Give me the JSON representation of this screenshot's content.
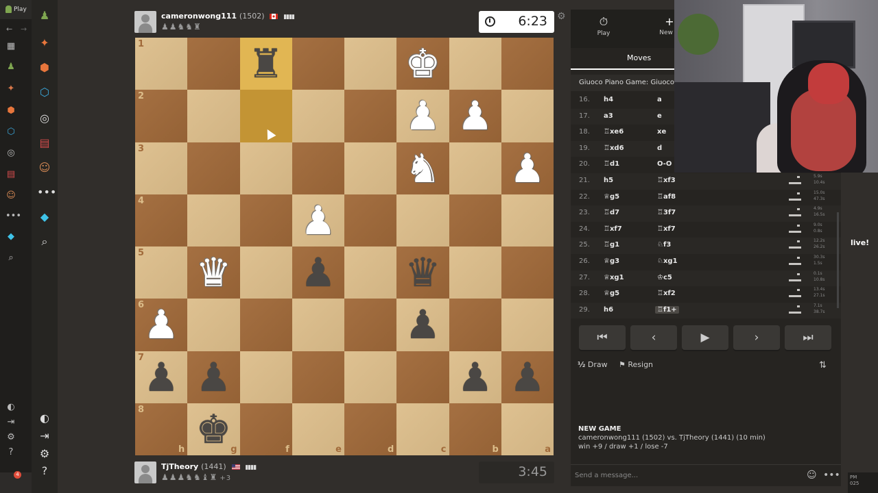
{
  "browser": {
    "tab_label": "Play",
    "notification_count": "4",
    "tray_time": "PM",
    "tray_date": "025"
  },
  "top_player": {
    "name": "cameronwong111",
    "rating": "(1502)",
    "flag": "Canada",
    "captured": "♟♟♞♞♜",
    "clock": "6:23",
    "clock_active": true
  },
  "bottom_player": {
    "name": "TjTheory",
    "rating": "(1441)",
    "flag": "USA",
    "captured": "♟♟♟♞♞♝♜",
    "advantage": "+3",
    "clock": "3:45",
    "clock_active": false
  },
  "board": {
    "orientation": "black",
    "ranks": [
      "1",
      "2",
      "3",
      "4",
      "5",
      "6",
      "7",
      "8"
    ],
    "files": [
      "h",
      "g",
      "f",
      "e",
      "d",
      "c",
      "b",
      "a"
    ],
    "highlighted": [
      "f1",
      "f2"
    ],
    "pieces": [
      {
        "sq": "f1",
        "glyph": "♜",
        "color": "b"
      },
      {
        "sq": "c1",
        "glyph": "♚",
        "color": "w"
      },
      {
        "sq": "c2",
        "glyph": "♟",
        "color": "w"
      },
      {
        "sq": "b2",
        "glyph": "♟",
        "color": "w"
      },
      {
        "sq": "c3",
        "glyph": "♞",
        "color": "w"
      },
      {
        "sq": "a3",
        "glyph": "♟",
        "color": "w"
      },
      {
        "sq": "e4",
        "glyph": "♟",
        "color": "w"
      },
      {
        "sq": "g5",
        "glyph": "♛",
        "color": "w"
      },
      {
        "sq": "e5",
        "glyph": "♟",
        "color": "b"
      },
      {
        "sq": "c5",
        "glyph": "♛",
        "color": "b"
      },
      {
        "sq": "h6",
        "glyph": "♟",
        "color": "w"
      },
      {
        "sq": "c6",
        "glyph": "♟",
        "color": "b"
      },
      {
        "sq": "h7",
        "glyph": "♟",
        "color": "b"
      },
      {
        "sq": "g7",
        "glyph": "♟",
        "color": "b"
      },
      {
        "sq": "b7",
        "glyph": "♟",
        "color": "b"
      },
      {
        "sq": "a7",
        "glyph": "♟",
        "color": "b"
      },
      {
        "sq": "g8",
        "glyph": "♚",
        "color": "b"
      }
    ]
  },
  "panel": {
    "tabs": [
      {
        "label": "Play",
        "icon": "+"
      },
      {
        "label": "New G",
        "icon": "+"
      }
    ],
    "moves_tab": "Moves",
    "opening": "Giuoco Piano Game: Giuoco Pi",
    "moves": [
      {
        "num": "16.",
        "white": "h4",
        "black": "a"
      },
      {
        "num": "17.",
        "white": "a3",
        "black": "e"
      },
      {
        "num": "18.",
        "white": "♖xe6",
        "black": "xe"
      },
      {
        "num": "19.",
        "white": "♖xd6",
        "black": "d"
      },
      {
        "num": "20.",
        "white": "♖d1",
        "black": "O-O"
      },
      {
        "num": "21.",
        "white": "h5",
        "black": "♖xf3"
      },
      {
        "num": "22.",
        "white": "♕g5",
        "black": "♖af8"
      },
      {
        "num": "23.",
        "white": "♖d7",
        "black": "♖3f7"
      },
      {
        "num": "24.",
        "white": "♖xf7",
        "black": "♖xf7"
      },
      {
        "num": "25.",
        "white": "♖g1",
        "black": "♘f3"
      },
      {
        "num": "26.",
        "white": "♕g3",
        "black": "♘xg1"
      },
      {
        "num": "27.",
        "white": "♕xg1",
        "black": "♔c5"
      },
      {
        "num": "28.",
        "white": "♕g5",
        "black": "♖xf2"
      },
      {
        "num": "29.",
        "white": "h6",
        "black": "♖f1+"
      }
    ],
    "move_times": [
      {
        "row": 5,
        "a": "5.9s",
        "b": "10.4s"
      },
      {
        "row": 6,
        "a": "15.0s",
        "b": "47.3s"
      },
      {
        "row": 7,
        "a": "4.9s",
        "b": "16.5s"
      },
      {
        "row": 8,
        "a": "9.0s",
        "b": "0.8s"
      },
      {
        "row": 9,
        "a": "12.2s",
        "b": "26.2s"
      },
      {
        "row": 10,
        "a": "30.3s",
        "b": "1.5s"
      },
      {
        "row": 11,
        "a": "0.1s",
        "b": "10.8s"
      },
      {
        "row": 12,
        "a": "13.4s",
        "b": "27.1s"
      },
      {
        "row": 13,
        "a": "7.1s",
        "b": "38.7s"
      }
    ],
    "nav_icons": [
      "⏮",
      "‹",
      "▶",
      "›",
      "⏭"
    ],
    "draw_label": "Draw",
    "draw_icon": "½",
    "resign_label": "Resign",
    "new_game_title": "NEW GAME",
    "new_game_line": "cameronwong111 (1502) vs. TjTheory (1441) (10 min)",
    "new_game_stats": "win +9 / draw +1 / lose -7",
    "chat_placeholder": "Send a message..."
  },
  "overlay": {
    "live_text": "live!"
  },
  "colors": {
    "light_square": "#dcbd8a",
    "dark_square": "#a16a3a",
    "highlight": "#e1b653",
    "accent_green": "#7fa650"
  }
}
